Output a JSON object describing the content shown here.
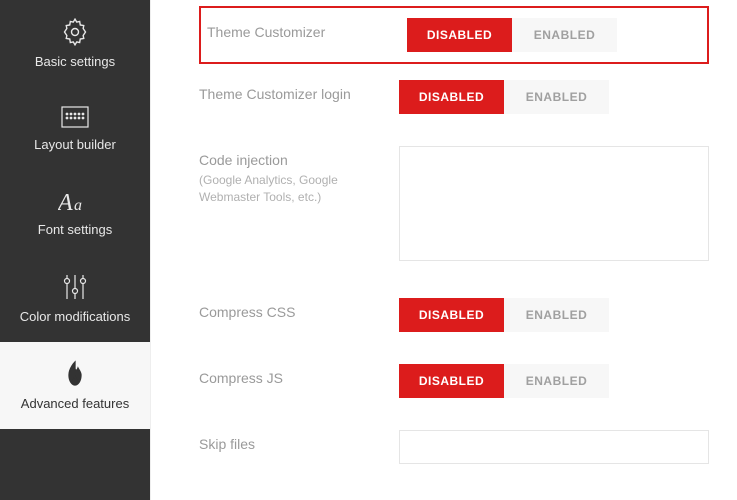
{
  "sidebar": {
    "items": [
      {
        "label": "Basic settings"
      },
      {
        "label": "Layout builder"
      },
      {
        "label": "Font settings"
      },
      {
        "label": "Color modifications"
      },
      {
        "label": "Advanced features"
      }
    ]
  },
  "toggle": {
    "disabled": "DISABLED",
    "enabled": "ENABLED"
  },
  "rows": {
    "themeCustomizer": {
      "label": "Theme Customizer"
    },
    "themeCustomizerLogin": {
      "label": "Theme Customizer login"
    },
    "codeInjection": {
      "label": "Code injection",
      "sublabel": "(Google Analytics, Google Webmaster Tools, etc.)"
    },
    "compressCSS": {
      "label": "Compress CSS"
    },
    "compressJS": {
      "label": "Compress JS"
    },
    "skipFiles": {
      "label": "Skip files"
    }
  }
}
